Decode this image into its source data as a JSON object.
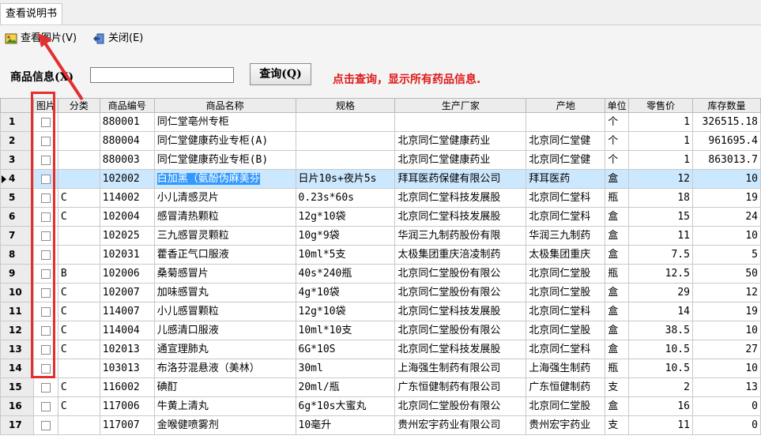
{
  "tab": {
    "label": "查看说明书"
  },
  "toolbar": {
    "view_image": "查看图片(V)",
    "close": "关闭(E)"
  },
  "search": {
    "label": "商品信息(X)",
    "value": "",
    "button": "查询(Q)",
    "hint": "点击查询，显示所有药品信息."
  },
  "table": {
    "columns": [
      "图片",
      "分类",
      "商品编号",
      "商品名称",
      "规格",
      "生产厂家",
      "产地",
      "单位",
      "零售价",
      "库存数量"
    ],
    "rows": [
      {
        "no": "1",
        "cat": "",
        "code": "880001",
        "name": "同仁堂亳州专柜",
        "spec": "",
        "maker": "",
        "origin": "",
        "unit": "个",
        "price": "1",
        "stock": "326515.18"
      },
      {
        "no": "2",
        "cat": "",
        "code": "880004",
        "name": "同仁堂健康药业专柜(A)",
        "spec": "",
        "maker": "北京同仁堂健康药业",
        "origin": "北京同仁堂健",
        "unit": "个",
        "price": "1",
        "stock": "961695.4"
      },
      {
        "no": "3",
        "cat": "",
        "code": "880003",
        "name": "同仁堂健康药业专柜(B)",
        "spec": "",
        "maker": "北京同仁堂健康药业",
        "origin": "北京同仁堂健",
        "unit": "个",
        "price": "1",
        "stock": "863013.7"
      },
      {
        "no": "4",
        "cat": "",
        "code": "102002",
        "name": "白加黑（氨酚伪麻美芬",
        "spec": "日片10s+夜片5s",
        "maker": "拜耳医药保健有限公司",
        "origin": "拜耳医药",
        "unit": "盒",
        "price": "12",
        "stock": "10"
      },
      {
        "no": "5",
        "cat": "C",
        "code": "114002",
        "name": "小儿清感灵片",
        "spec": "0.23s*60s",
        "maker": "北京同仁堂科技发展股",
        "origin": "北京同仁堂科",
        "unit": "瓶",
        "price": "18",
        "stock": "19"
      },
      {
        "no": "6",
        "cat": "C",
        "code": "102004",
        "name": "感冒清热颗粒",
        "spec": "12g*10袋",
        "maker": "北京同仁堂科技发展股",
        "origin": "北京同仁堂科",
        "unit": "盒",
        "price": "15",
        "stock": "24"
      },
      {
        "no": "7",
        "cat": "",
        "code": "102025",
        "name": "三九感冒灵颗粒",
        "spec": "10g*9袋",
        "maker": "华润三九制药股份有限",
        "origin": "华润三九制药",
        "unit": "盒",
        "price": "11",
        "stock": "10"
      },
      {
        "no": "8",
        "cat": "",
        "code": "102031",
        "name": "藿香正气口服液",
        "spec": "10ml*5支",
        "maker": "太极集团重庆涪凌制药",
        "origin": "太极集团重庆",
        "unit": "盒",
        "price": "7.5",
        "stock": "5"
      },
      {
        "no": "9",
        "cat": "B",
        "code": "102006",
        "name": "桑菊感冒片",
        "spec": "40s*240瓶",
        "maker": "北京同仁堂股份有限公",
        "origin": "北京同仁堂股",
        "unit": "瓶",
        "price": "12.5",
        "stock": "50"
      },
      {
        "no": "10",
        "cat": "C",
        "code": "102007",
        "name": "加味感冒丸",
        "spec": "4g*10袋",
        "maker": "北京同仁堂股份有限公",
        "origin": "北京同仁堂股",
        "unit": "盒",
        "price": "29",
        "stock": "12"
      },
      {
        "no": "11",
        "cat": "C",
        "code": "114007",
        "name": "小儿感冒颗粒",
        "spec": "12g*10袋",
        "maker": "北京同仁堂科技发展股",
        "origin": "北京同仁堂科",
        "unit": "盒",
        "price": "14",
        "stock": "19"
      },
      {
        "no": "12",
        "cat": "C",
        "code": "114004",
        "name": "儿感清口服液",
        "spec": "10ml*10支",
        "maker": "北京同仁堂股份有限公",
        "origin": "北京同仁堂股",
        "unit": "盒",
        "price": "38.5",
        "stock": "10"
      },
      {
        "no": "13",
        "cat": "C",
        "code": "102013",
        "name": "通宣理肺丸",
        "spec": "6G*10S",
        "maker": "北京同仁堂科技发展股",
        "origin": "北京同仁堂科",
        "unit": "盒",
        "price": "10.5",
        "stock": "27"
      },
      {
        "no": "14",
        "cat": "",
        "code": "103013",
        "name": "布洛芬混悬液（美林）",
        "spec": "30ml",
        "maker": "上海强生制药有限公司",
        "origin": "上海强生制药",
        "unit": "瓶",
        "price": "10.5",
        "stock": "10"
      },
      {
        "no": "15",
        "cat": "C",
        "code": "116002",
        "name": "碘酊",
        "spec": "20ml/瓶",
        "maker": "广东恒健制药有限公司",
        "origin": "广东恒健制药",
        "unit": "支",
        "price": "2",
        "stock": "13"
      },
      {
        "no": "16",
        "cat": "C",
        "code": "117006",
        "name": "牛黄上清丸",
        "spec": "6g*10s大蜜丸",
        "maker": "北京同仁堂股份有限公",
        "origin": "北京同仁堂股",
        "unit": "盒",
        "price": "16",
        "stock": "0"
      },
      {
        "no": "17",
        "cat": "",
        "code": "117007",
        "name": "金喉健喷雾剂",
        "spec": "10毫升",
        "maker": "贵州宏宇药业有限公司",
        "origin": "贵州宏宇药业",
        "unit": "支",
        "price": "11",
        "stock": "0"
      }
    ]
  },
  "colors": {
    "hint": "#e01818",
    "annotation": "#e23030",
    "selected_row": "#cce8ff",
    "selected_cell": "#3399ff"
  }
}
